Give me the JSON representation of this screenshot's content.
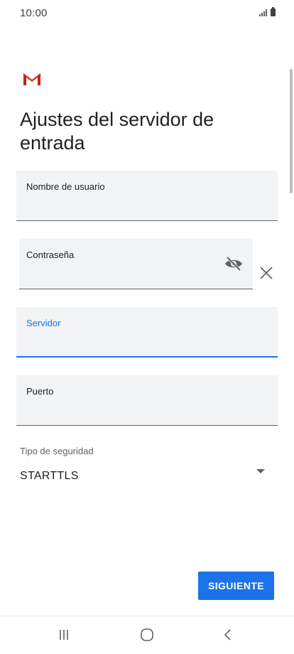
{
  "status_bar": {
    "time": "10:00"
  },
  "header": {
    "logo": "gmail-logo",
    "title": "Ajustes del servidor de entrada"
  },
  "form": {
    "username": {
      "label": "Nombre de usuario",
      "value": ""
    },
    "password": {
      "label": "Contraseña",
      "value": "",
      "toggle_icon": "eye-off-icon",
      "clear_icon": "close-icon"
    },
    "server": {
      "label": "Servidor",
      "value": "",
      "focused": true
    },
    "port": {
      "label": "Puerto",
      "value": ""
    },
    "security": {
      "label": "Tipo de seguridad",
      "value": "STARTTLS",
      "icon": "dropdown-arrow-icon"
    }
  },
  "actions": {
    "next_label": "SIGUIENTE"
  },
  "nav": {
    "recents_icon": "recents-icon",
    "home_icon": "home-icon",
    "back_icon": "back-icon"
  },
  "colors": {
    "accent": "#1a73e8",
    "field_bg": "#f1f3f4",
    "gmail_red": "#d93025"
  }
}
